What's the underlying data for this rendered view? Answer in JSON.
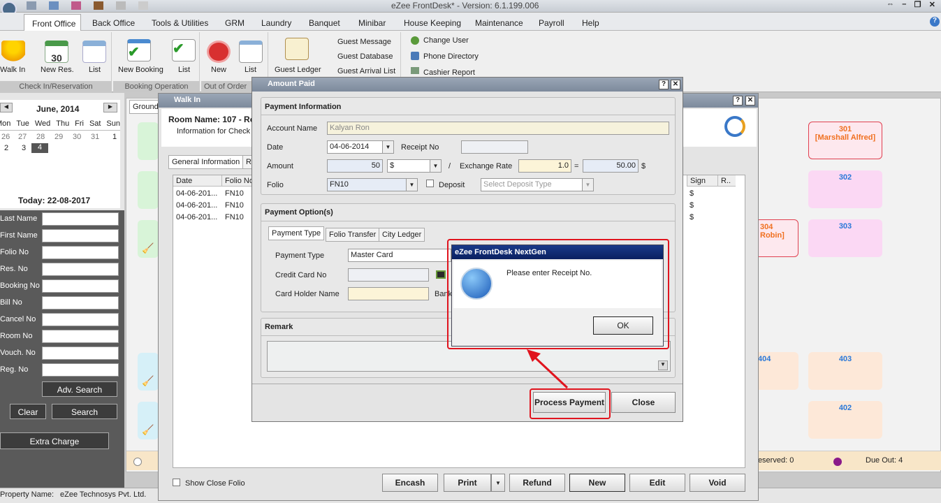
{
  "app": {
    "title": "eZee FrontDesk* - Version: 6.1.199.006"
  },
  "menu": [
    "Front Office",
    "Back Office",
    "Tools & Utilities",
    "GRM",
    "Laundry",
    "Banquet",
    "Minibar",
    "House Keeping",
    "Maintenance",
    "Payroll",
    "Help"
  ],
  "ribbon": {
    "checkin_group": "Check In/Reservation",
    "walk_in": "Walk In",
    "new_res": "New Res.",
    "list1": "List",
    "booking_group": "Booking Operation",
    "new_booking": "New Booking",
    "list2": "List",
    "ooo_group": "Out of Order",
    "new": "New",
    "list3": "List",
    "guest_ledger": "Guest Ledger",
    "guest_message": "Guest Message",
    "guest_database": "Guest Database",
    "guest_arrival": "Guest Arrival List",
    "change_user": "Change User",
    "phone_directory": "Phone Directory",
    "cashier_report": "Cashier Report",
    "cal_day": "30"
  },
  "calendar": {
    "month": "June, 2014",
    "days": [
      "Mon",
      "Tue",
      "Wed",
      "Thu",
      "Fri",
      "Sat",
      "Sun"
    ],
    "row1": [
      "26",
      "27",
      "28",
      "29",
      "30",
      "31",
      "1"
    ],
    "row2": [
      "2",
      "3",
      "4"
    ],
    "today": "Today: 22-08-2017"
  },
  "search": {
    "labels": [
      "Last Name",
      "First Name",
      "Folio No",
      "Res. No",
      "Booking No",
      "Bill No",
      "Cancel No",
      "Room No",
      "Vouch. No",
      "Reg. No"
    ],
    "adv": "Adv. Search",
    "clear": "Clear",
    "search": "Search",
    "extra": "Extra Charge"
  },
  "status": {
    "property_label": "Property Name:",
    "property": "eZee Technosys Pvt. Ltd.",
    "reserved": "Reserved: 0",
    "due_out": "Due Out: 4"
  },
  "ground_tab": "Ground",
  "rooms": [
    {
      "num": "301",
      "name": "[Marshall Alfred]"
    },
    {
      "num": "302"
    },
    {
      "num": "304",
      "name": "Robin]"
    },
    {
      "num": "303"
    },
    {
      "num": "404"
    },
    {
      "num": "403"
    },
    {
      "num": "402"
    }
  ],
  "walkin": {
    "title": "Walk In",
    "room_name": "Room Name: 107 - Ro",
    "info": "Information for Check",
    "tabs": [
      "General Information",
      "R"
    ],
    "cols": [
      "Date",
      "Folio No",
      "Sign",
      "R.."
    ],
    "rows": [
      {
        "date": "04-06-201...",
        "folio": "FN10",
        "sign": "$"
      },
      {
        "date": "04-06-201...",
        "folio": "FN10",
        "sign": "$"
      },
      {
        "date": "04-06-201...",
        "folio": "FN10",
        "sign": "$"
      }
    ],
    "show_close": "Show Close Folio",
    "buttons": [
      "Encash",
      "Print",
      "Refund",
      "New",
      "Edit",
      "Void"
    ]
  },
  "amount": {
    "title": "Amount Paid",
    "payment_info": "Payment Information",
    "account_name_label": "Account Name",
    "account_name": "Kalyan Ron",
    "date_label": "Date",
    "date": "04-06-2014",
    "receipt_label": "Receipt No",
    "receipt": "",
    "amount_label": "Amount",
    "amount": "50",
    "currency": "$",
    "slash": "/",
    "exchange_label": "Exchange Rate",
    "exchange": "1.0",
    "eq": "=",
    "converted": "50.00",
    "conv_cur": "$",
    "folio_label": "Folio",
    "folio": "FN10",
    "deposit_label": "Deposit",
    "deposit_placeholder": "Select Deposit Type",
    "payment_options": "Payment Option(s)",
    "tabs": [
      "Payment Type",
      "Folio Transfer",
      "City Ledger"
    ],
    "payment_type_label": "Payment Type",
    "payment_type": "Master Card",
    "cc_label": "Credit Card No",
    "holder_label": "Card Holder Name",
    "bank": "Bank",
    "remark": "Remark",
    "process": "Process Payment",
    "close": "Close"
  },
  "msgbox": {
    "title": "eZee FrontDesk NextGen",
    "message": "Please enter Receipt No.",
    "ok": "OK"
  },
  "colors": {
    "highlight": "#e0141e",
    "ribbon_bg": "#efefef",
    "title_bar": "#8a96a8"
  }
}
